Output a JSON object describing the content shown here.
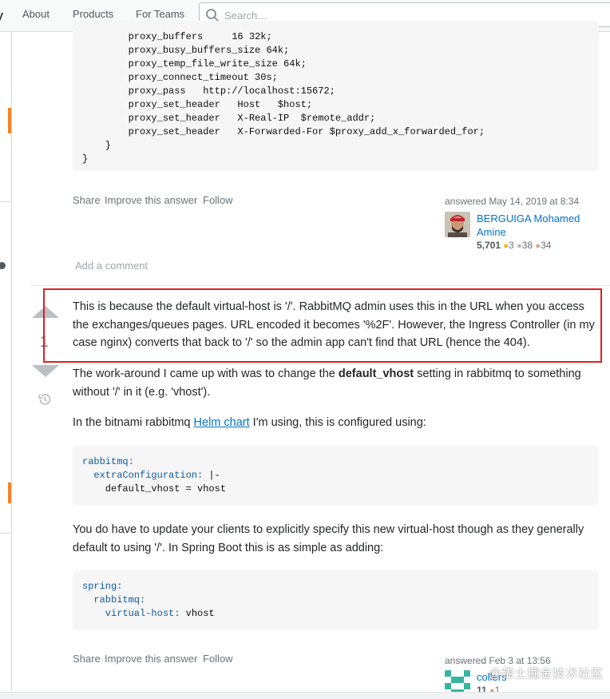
{
  "nav": {
    "about": "About",
    "products": "Products",
    "for_teams": "For Teams"
  },
  "search": {
    "placeholder": "Search…"
  },
  "code1": {
    "lines": [
      "        proxy_buffers     16 32k;",
      "        proxy_busy_buffers_size 64k;",
      "        proxy_temp_file_write_size 64k;",
      "        proxy_connect_timeout 30s;",
      "        proxy_pass   http://localhost:15672;",
      "        proxy_set_header   Host   $host;",
      "        proxy_set_header   X-Real-IP  $remote_addr;",
      "        proxy_set_header   X-Forwarded-For $proxy_add_x_forwarded_for;",
      "    }",
      "}"
    ]
  },
  "post1": {
    "share": "Share",
    "improve": "Improve this answer",
    "follow": "Follow",
    "answered": "answered May 14, 2019 at 8:34",
    "user_first": "BERGUIGA Mohamed",
    "user_second": "Amine",
    "rep": "5,701",
    "gold": "3",
    "silver": "38",
    "bronze": "34",
    "add_comment": "Add a comment"
  },
  "answer2": {
    "vote_count": "1",
    "p1": "This is because the default virtual-host is '/'. RabbitMQ admin uses this in the URL when you access the exchanges/queues pages. URL encoded it becomes '%2F'. However, the Ingress Controller (in my case nginx) converts that back to '/' so the admin app can't find that URL (hence the 404).",
    "p2_before": "The work-around I came up with was to change the ",
    "p2_bold": "default_vhost",
    "p2_after": " setting in rabbitmq to something without '/' in it (e.g. 'vhost').",
    "p3_before": "In the bitnami rabbitmq ",
    "p3_link": "Helm chart",
    "p3_after": " I'm using, this is configured using:",
    "code2": {
      "l1": "rabbitmq:",
      "l2_key": "  extraConfiguration:",
      "l2_val": " |-",
      "l3": "    default_vhost = vhost"
    },
    "p4": "You do have to update your clients to explicitly specify this new virtual-host though as they generally default to using '/'. In Spring Boot this is as simple as adding:",
    "code3": {
      "l1": "spring:",
      "l2": "  rabbitmq:",
      "l3_key": "    virtual-host:",
      "l3_val": " vhost"
    },
    "share": "Share",
    "improve": "Improve this answer",
    "follow": "Follow",
    "answered": "answered Feb 3 at 13:56",
    "user": "collers",
    "rep": "11",
    "bronze": "1"
  },
  "watermark": "@稀土掘金技术社区"
}
